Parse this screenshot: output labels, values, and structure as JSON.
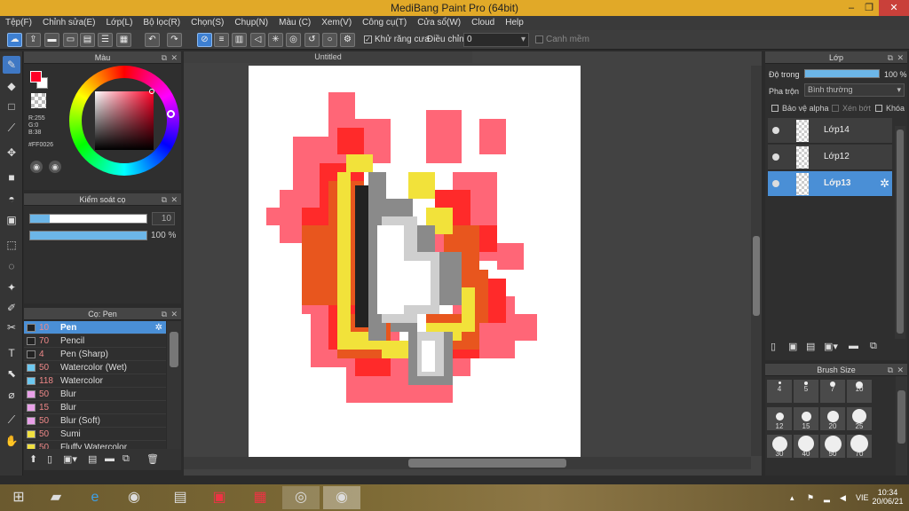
{
  "window": {
    "title": "MediBang Paint Pro (64bit)",
    "min": "–",
    "max": "❐",
    "close": "✕"
  },
  "menu": [
    "Tệp(F)",
    "Chỉnh sửa(E)",
    "Lớp(L)",
    "Bộ lọc(R)",
    "Chọn(S)",
    "Chụp(N)",
    "Màu (C)",
    "Xem(V)",
    "Công cụ(T)",
    "Cửa sổ(W)",
    "Cloud",
    "Help"
  ],
  "toolbar": {
    "antialias_label": "Khử răng cưa",
    "adjust_label": "Điều chỉnh",
    "adjust_value": "0",
    "snap_label": "Canh mềm",
    "antialias_checked": true,
    "snap_checked": false
  },
  "color_panel": {
    "title": "Màu",
    "r": "R:255",
    "g": "G:0",
    "b": "B:38",
    "hex": "#FF0026",
    "primary": "#ff0026",
    "secondary": "#ffffff"
  },
  "brush_control": {
    "title": "Kiểm soát cọ",
    "size_value": "10",
    "opacity_value": "100 %",
    "size_fraction": 0.17,
    "opacity_fraction": 1.0
  },
  "brush_panel": {
    "title": "Cọ: Pen",
    "items": [
      {
        "num": "10",
        "name": "Pen",
        "color": "#222222",
        "selected": true
      },
      {
        "num": "70",
        "name": "Pencil",
        "color": "#222222"
      },
      {
        "num": "4",
        "name": "Pen (Sharp)",
        "color": "#222222"
      },
      {
        "num": "50",
        "name": "Watercolor (Wet)",
        "color": "#6cc8f0"
      },
      {
        "num": "118",
        "name": "Watercolor",
        "color": "#6cc8f0"
      },
      {
        "num": "50",
        "name": "Blur",
        "color": "#e8a0e8"
      },
      {
        "num": "15",
        "name": "Blur",
        "color": "#e8a0e8"
      },
      {
        "num": "50",
        "name": "Blur (Soft)",
        "color": "#e8a0e8"
      },
      {
        "num": "50",
        "name": "Sumi",
        "color": "#f0e040"
      },
      {
        "num": "50",
        "name": "Fluffy Watercolor",
        "color": "#f0e040"
      },
      {
        "num": "100",
        "name": "Light 2",
        "color": "#a0e060"
      }
    ]
  },
  "canvas": {
    "tab_title": "Untitled"
  },
  "layer_panel": {
    "title": "Lớp",
    "opacity_label": "Độ trong",
    "opacity_value": "100 %",
    "opacity_fraction": 1.0,
    "blend_label": "Pha trộn",
    "blend_value": "Bình thường",
    "protect_alpha": "Bảo vệ alpha",
    "clip": "Xén bớt",
    "lock": "Khóa",
    "layers": [
      {
        "name": "Lớp14",
        "selected": false
      },
      {
        "name": "Lớp12",
        "selected": false
      },
      {
        "name": "Lớp13",
        "selected": true
      }
    ]
  },
  "brush_size": {
    "title": "Brush Size",
    "sizes": [
      "4",
      "5",
      "7",
      "10",
      "12",
      "15",
      "20",
      "25",
      "30",
      "40",
      "50",
      "70"
    ]
  },
  "taskbar": {
    "lang": "VIE",
    "time": "10:34",
    "date": "20/06/21"
  },
  "colors": {
    "accent": "#3f78c4",
    "titlebar": "#e1a928",
    "flame_outer": "#ff6677",
    "flame_mid": "#ff2a2a",
    "flame_inner": "#e8561e",
    "yellow": "#f2e23a"
  }
}
